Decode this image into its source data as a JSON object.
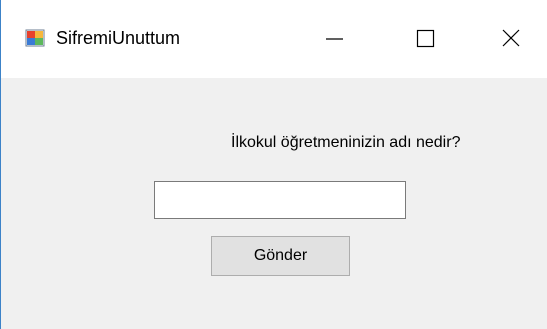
{
  "window": {
    "title": "SifremiUnuttum",
    "icon": "winforms-app-icon",
    "controls": {
      "minimize_icon": "minimize-icon",
      "maximize_icon": "maximize-icon",
      "close_icon": "close-icon"
    },
    "accent_border_color": "#3c82c8"
  },
  "form": {
    "question": "İlkokul öğretmeninizin adı nedir?",
    "answer_value": "",
    "submit_label": "Gönder"
  }
}
